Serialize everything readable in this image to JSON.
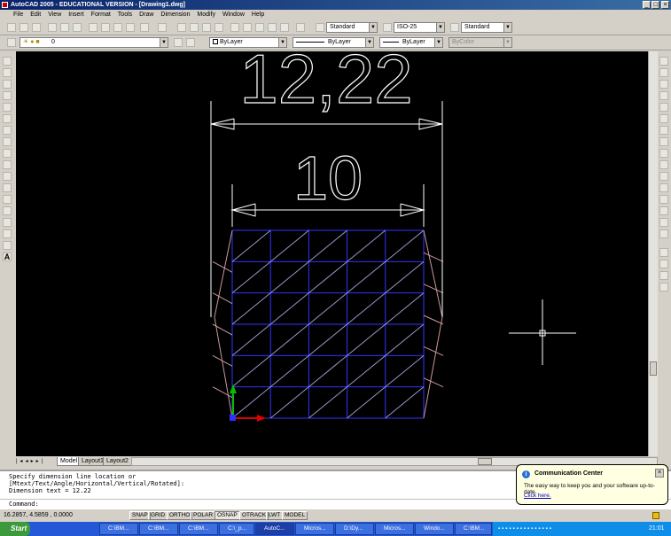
{
  "window": {
    "title": "AutoCAD 2005 - EDUCATIONAL VERSION - [Drawing1.dwg]"
  },
  "menu": [
    "File",
    "Edit",
    "View",
    "Insert",
    "Format",
    "Tools",
    "Draw",
    "Dimension",
    "Modify",
    "Window",
    "Help"
  ],
  "styles": {
    "text_style": "Standard",
    "dim_style": "ISO-25",
    "table_style": "Standard"
  },
  "layers": {
    "current": "0",
    "color": "ByLayer",
    "linetype": "ByLayer",
    "lineweight": "ByLayer",
    "plotstyle": "ByColor"
  },
  "drawing": {
    "dim_outer": "12,22",
    "dim_inner": "10",
    "grid_color": "#3333ff",
    "diag_color": "#9999cc",
    "curve_color": "#cc9999"
  },
  "tabs": [
    "Model",
    "Layout1",
    "Layout2"
  ],
  "command": {
    "lines": [
      "Specify dimension line location or",
      "[Mtext/Text/Angle/Horizontal/Vertical/Rotated]:",
      "Dimension text = 12.22"
    ],
    "prompt": "Command:"
  },
  "status": {
    "coords": "16.2857, 4.5859 , 0.0000",
    "toggles": [
      "SNAP",
      "GRID",
      "ORTHO",
      "POLAR",
      "OSNAP",
      "OTRACK",
      "LWT",
      "MODEL"
    ]
  },
  "balloon": {
    "title": "Communication Center",
    "text": "The easy way to keep you and your software up-to-date.",
    "link": "Click here."
  },
  "taskbar": {
    "start": "Start",
    "tasks": [
      "C:\\BM...",
      "C:\\BM...",
      "C:\\BM...",
      "C:\\_p...",
      "AutoC...",
      "Micros...",
      "D:\\Dy...",
      "Micros...",
      "Windo...",
      "C:\\BM..."
    ],
    "clock": "21:01"
  }
}
